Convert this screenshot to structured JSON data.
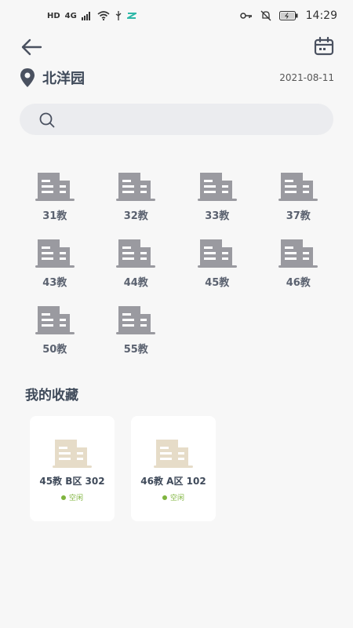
{
  "status_bar": {
    "network_label": "4G",
    "time": "14:29",
    "hd_label": "HD"
  },
  "header": {
    "campus_name": "北洋园",
    "date": "2021-08-11"
  },
  "search": {
    "value": "",
    "placeholder": ""
  },
  "buildings": [
    {
      "label": "31教"
    },
    {
      "label": "32教"
    },
    {
      "label": "33教"
    },
    {
      "label": "37教"
    },
    {
      "label": "43教"
    },
    {
      "label": "44教"
    },
    {
      "label": "45教"
    },
    {
      "label": "46教"
    },
    {
      "label": "50教"
    },
    {
      "label": "55教"
    }
  ],
  "favorites": {
    "title": "我的收藏",
    "items": [
      {
        "room": "45教 B区 302",
        "status": "空闲"
      },
      {
        "room": "46教 A区 102",
        "status": "空闲"
      }
    ]
  },
  "colors": {
    "building_icon": "#9a9aa0",
    "favorite_icon": "#e6dcc8",
    "free_status": "#7fb43e",
    "text_dark": "#3f4a5a"
  }
}
